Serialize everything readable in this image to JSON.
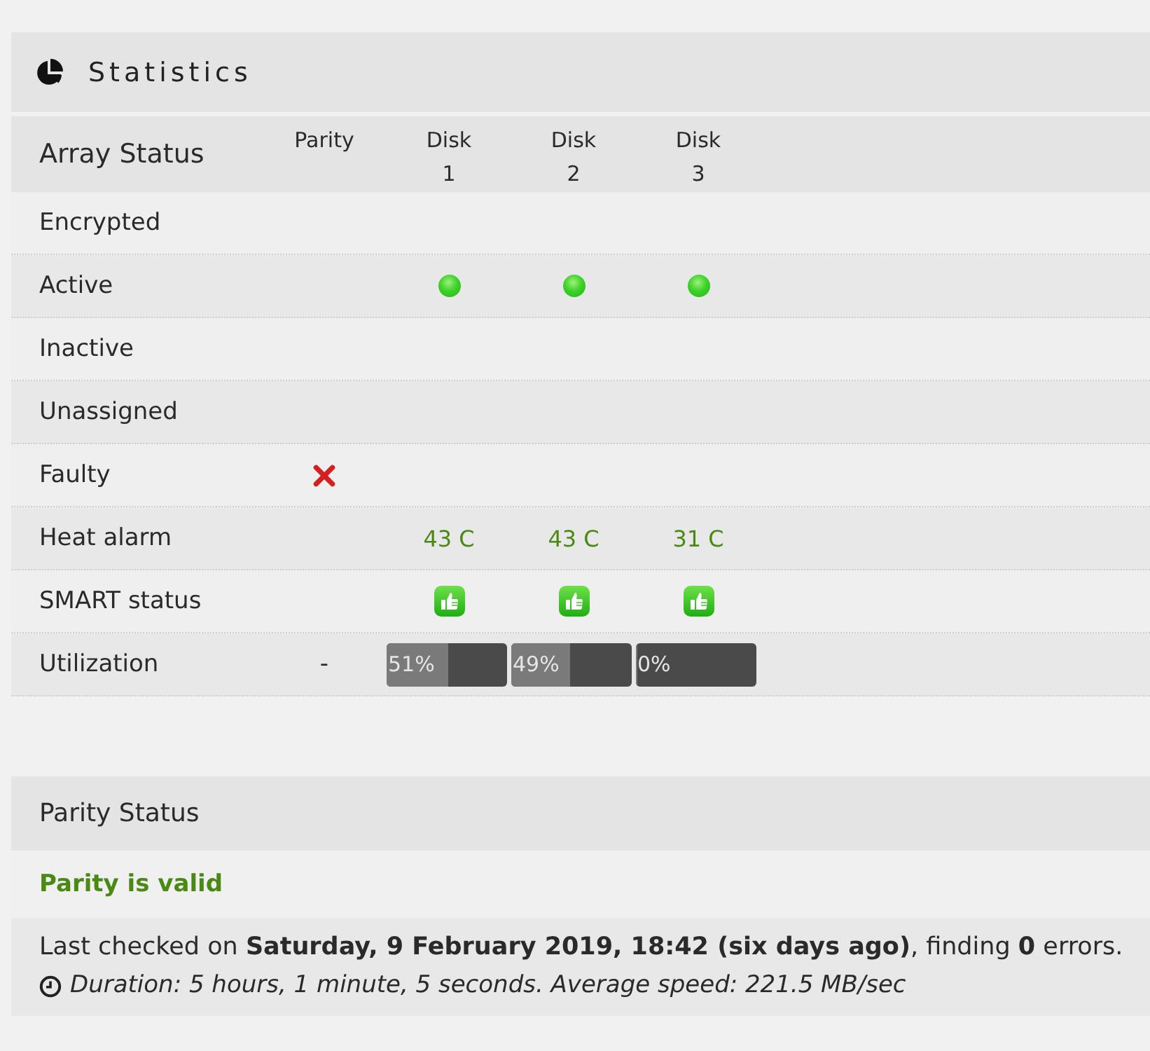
{
  "statistics": {
    "title": "Statistics",
    "table": {
      "title": "Array Status",
      "columns": [
        "Parity",
        "Disk 1",
        "Disk 2",
        "Disk 3"
      ],
      "rows": [
        {
          "label": "Encrypted"
        },
        {
          "label": "Active",
          "cells": [
            {
              "kind": "empty"
            },
            {
              "kind": "led"
            },
            {
              "kind": "led"
            },
            {
              "kind": "led"
            }
          ]
        },
        {
          "label": "Inactive"
        },
        {
          "label": "Unassigned"
        },
        {
          "label": "Faulty",
          "cells": [
            {
              "kind": "cross"
            }
          ]
        },
        {
          "label": "Heat alarm",
          "cells": [
            {
              "kind": "empty"
            },
            {
              "kind": "temp",
              "text": "43 C"
            },
            {
              "kind": "temp",
              "text": "43 C"
            },
            {
              "kind": "temp",
              "text": "31 C"
            }
          ]
        },
        {
          "label": "SMART status",
          "cells": [
            {
              "kind": "empty"
            },
            {
              "kind": "thumb"
            },
            {
              "kind": "thumb"
            },
            {
              "kind": "thumb"
            }
          ]
        },
        {
          "label": "Utilization",
          "cells": [
            {
              "kind": "text",
              "text": "-"
            },
            {
              "kind": "bar",
              "level": 0.51,
              "text": "51%"
            },
            {
              "kind": "bar",
              "level": 0.49,
              "text": "49%"
            },
            {
              "kind": "bar",
              "level": 0,
              "text": "0%"
            }
          ]
        }
      ]
    }
  },
  "parity_status": {
    "title": "Parity Status",
    "status": {
      "kind": "valid",
      "text": "Parity is valid"
    },
    "last_checked": "Last checked on **Saturday, 9 February 2019, 18:42 (six days ago)**, finding **0** errors.",
    "duration": "Duration: 5 hours, 1 minute, 5 seconds. Average speed: 221.5 MB/sec"
  }
}
